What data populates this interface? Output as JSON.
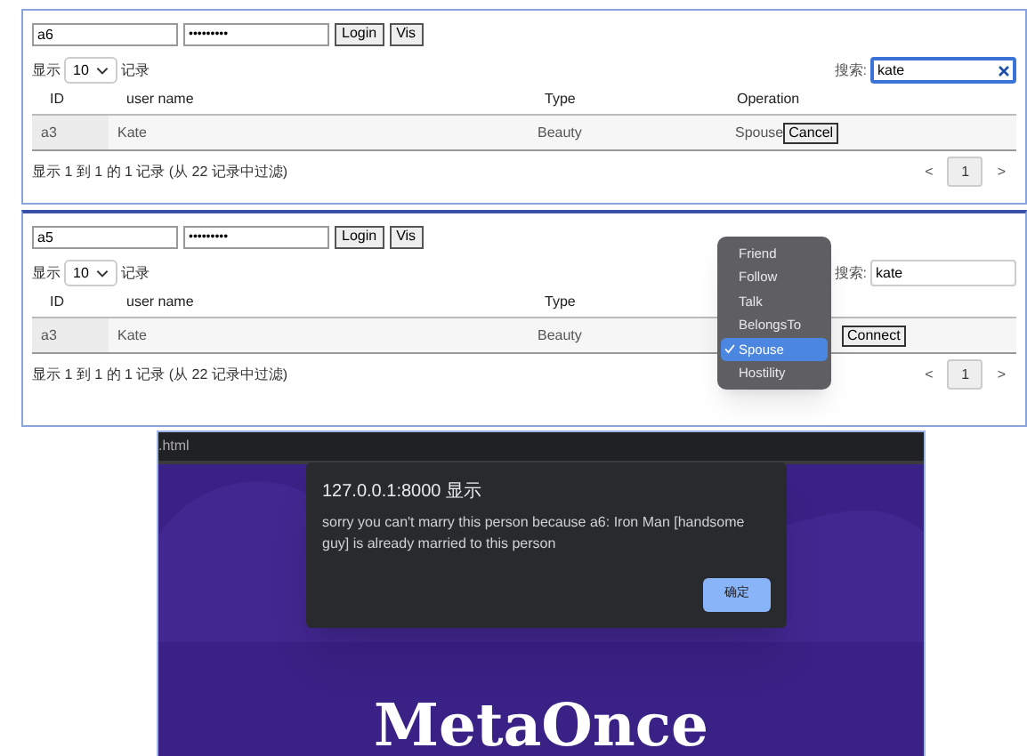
{
  "panels": [
    {
      "username": "a6",
      "password": "•••••••••",
      "buttons": [
        "Login",
        "Vis"
      ],
      "length": {
        "prefix": "显示",
        "value": "10",
        "suffix": "记录"
      },
      "search": {
        "label": "搜索:",
        "value": "kate",
        "focused": true,
        "clearable": true
      },
      "columns": [
        "ID",
        "user name",
        "Type",
        "Operation"
      ],
      "rows": [
        {
          "id": "a3",
          "name": "Kate",
          "type": "Beauty",
          "relation": "Spouse",
          "action": "Cancel"
        }
      ],
      "info": "显示 1 到 1 的 1 记录 (从 22 记录中过滤)",
      "pagination": {
        "prev": "<",
        "page": "1",
        "next": ">"
      }
    },
    {
      "username": "a5",
      "password": "•••••••••",
      "buttons": [
        "Login",
        "Vis"
      ],
      "length": {
        "prefix": "显示",
        "value": "10",
        "suffix": "记录"
      },
      "search": {
        "label": "搜索:",
        "value": "kate",
        "focused": false,
        "clearable": false
      },
      "columns": [
        "ID",
        "user name",
        "Type"
      ],
      "rows": [
        {
          "id": "a3",
          "name": "Kate",
          "type": "Beauty",
          "action": "Connect"
        }
      ],
      "info": "显示 1 到 1 的 1 记录 (从 22 记录中过滤)",
      "pagination": {
        "prev": "<",
        "page": "1",
        "next": ">"
      },
      "relation_menu": [
        {
          "label": "Friend",
          "selected": false
        },
        {
          "label": "Follow",
          "selected": false
        },
        {
          "label": "Talk",
          "selected": false
        },
        {
          "label": "BelongsTo",
          "selected": false
        },
        {
          "label": "Spouse",
          "selected": true
        },
        {
          "label": "Hostility",
          "selected": false
        }
      ]
    }
  ],
  "browser": {
    "title": ".html",
    "heading": "MetaOnce",
    "dialog": {
      "title": "127.0.0.1:8000 显示",
      "message": "sorry you can't marry this person because a6: Iron Man [handsome guy] is already married to this person",
      "button": "确定"
    }
  }
}
